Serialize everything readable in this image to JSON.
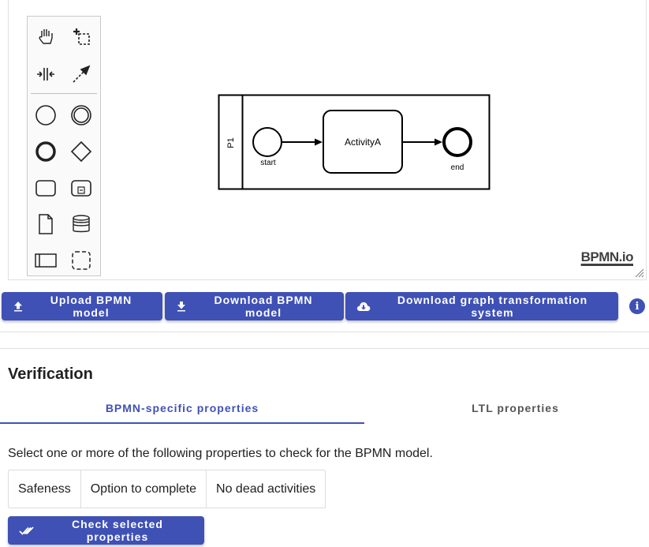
{
  "palette": {
    "tools": [
      {
        "name": "hand-tool-icon"
      },
      {
        "name": "lasso-tool-icon"
      },
      {
        "name": "space-tool-icon"
      },
      {
        "name": "connect-tool-icon"
      },
      {
        "name": "start-event-icon"
      },
      {
        "name": "intermediate-event-icon"
      },
      {
        "name": "end-event-icon"
      },
      {
        "name": "gateway-icon"
      },
      {
        "name": "task-icon"
      },
      {
        "name": "subprocess-icon"
      },
      {
        "name": "data-object-icon"
      },
      {
        "name": "data-store-icon"
      },
      {
        "name": "participant-icon"
      },
      {
        "name": "group-icon"
      }
    ]
  },
  "diagram": {
    "pool_label": "P1",
    "start_label": "start",
    "task_label": "ActivityA",
    "end_label": "end"
  },
  "logo": "BPMN.io",
  "toolbar": {
    "upload_label": "Upload BPMN model",
    "download_label": "Download BPMN model",
    "download_gts_label": "Download graph transformation system",
    "info_label": "i"
  },
  "verification": {
    "title": "Verification",
    "tabs": [
      {
        "label": "BPMN-specific properties",
        "active": true
      },
      {
        "label": "LTL properties",
        "active": false
      }
    ],
    "description": "Select one or more of the following properties to check for the BPMN model.",
    "properties": [
      "Safeness",
      "Option to complete",
      "No dead activities"
    ],
    "check_label": "Check selected properties"
  },
  "colors": {
    "primary": "#3f51b5",
    "palette_bg": "#fafafa"
  }
}
